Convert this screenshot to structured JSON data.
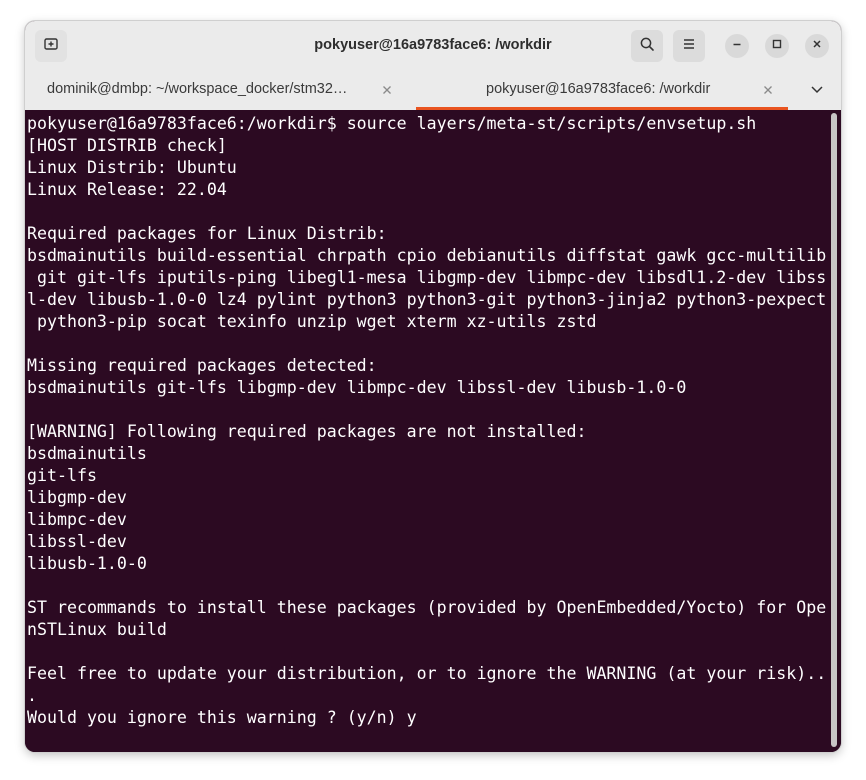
{
  "window": {
    "title": "pokyuser@16a9783face6: /workdir"
  },
  "icons": {
    "new_tab": "new-tab-icon",
    "search": "search-icon",
    "menu": "hamburger-menu-icon",
    "minimize": "minimize-icon",
    "maximize": "maximize-icon",
    "close": "close-icon",
    "tab_close": "close-icon",
    "tabs_dropdown": "chevron-down-icon"
  },
  "tabs": [
    {
      "label": "dominik@dmbp: ~/workspace_docker/stm32…",
      "active": false
    },
    {
      "label": "pokyuser@16a9783face6: /workdir",
      "active": true
    }
  ],
  "colors": {
    "terminal_bg": "#2c0a22",
    "accent": "#e95420",
    "header_bg": "#ebebeb"
  },
  "terminal": {
    "lines": [
      "pokyuser@16a9783face6:/workdir$ source layers/meta-st/scripts/envsetup.sh",
      "[HOST DISTRIB check]",
      "Linux Distrib: Ubuntu",
      "Linux Release: 22.04",
      "",
      "Required packages for Linux Distrib:",
      "bsdmainutils build-essential chrpath cpio debianutils diffstat gawk gcc-multilib",
      " git git-lfs iputils-ping libegl1-mesa libgmp-dev libmpc-dev libsdl1.2-dev libss",
      "l-dev libusb-1.0-0 lz4 pylint python3 python3-git python3-jinja2 python3-pexpect",
      " python3-pip socat texinfo unzip wget xterm xz-utils zstd",
      "",
      "Missing required packages detected:",
      "bsdmainutils git-lfs libgmp-dev libmpc-dev libssl-dev libusb-1.0-0",
      "",
      "[WARNING] Following required packages are not installed:",
      "bsdmainutils",
      "git-lfs",
      "libgmp-dev",
      "libmpc-dev",
      "libssl-dev",
      "libusb-1.0-0",
      "",
      "ST recommands to install these packages (provided by OpenEmbedded/Yocto) for Ope",
      "nSTLinux build",
      "",
      "Feel free to update your distribution, or to ignore the WARNING (at your risk)..",
      ".",
      "Would you ignore this warning ? (y/n) y"
    ]
  }
}
